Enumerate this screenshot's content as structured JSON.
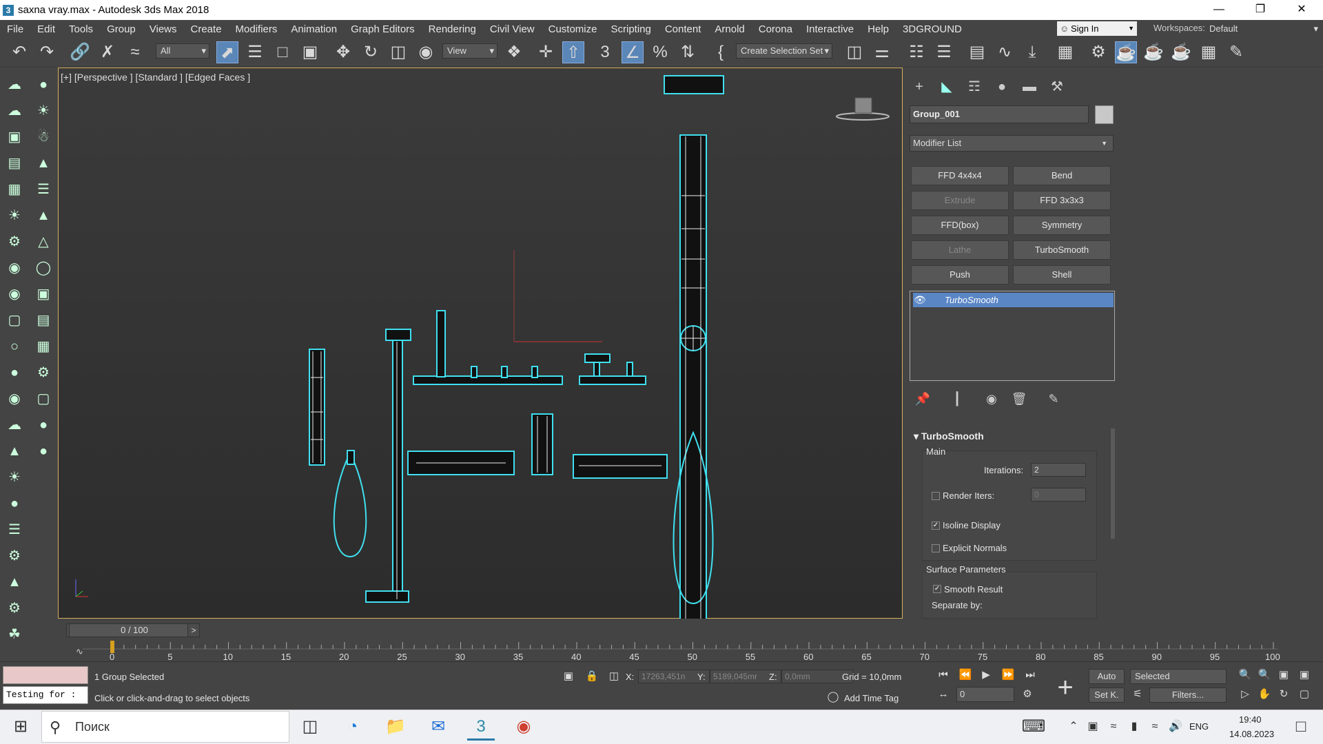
{
  "window": {
    "title": "saxna vray.max - Autodesk 3ds Max 2018",
    "minimize": "—",
    "restore": "❐",
    "close": "✕"
  },
  "menu": [
    "File",
    "Edit",
    "Tools",
    "Group",
    "Views",
    "Create",
    "Modifiers",
    "Animation",
    "Graph Editors",
    "Rendering",
    "Civil View",
    "Customize",
    "Scripting",
    "Content",
    "Arnold",
    "Corona",
    "Interactive",
    "Help",
    "3DGROUND"
  ],
  "signin": {
    "label": "Sign In"
  },
  "workspace": {
    "label": "Workspaces:",
    "value": "Default"
  },
  "toolbar": {
    "filter": "All",
    "refcoord": "View",
    "selset": "Create Selection Set"
  },
  "viewport": {
    "label": "[+] [Perspective ] [Standard ] [Edged Faces ]"
  },
  "command_panel": {
    "object_name": "Group_001",
    "modifier_list": "Modifier List",
    "buttons": [
      {
        "label": "FFD 4x4x4",
        "enabled": true
      },
      {
        "label": "Bend",
        "enabled": true
      },
      {
        "label": "Extrude",
        "enabled": false
      },
      {
        "label": "FFD 3x3x3",
        "enabled": true
      },
      {
        "label": "FFD(box)",
        "enabled": true
      },
      {
        "label": "Symmetry",
        "enabled": true
      },
      {
        "label": "Lathe",
        "enabled": false
      },
      {
        "label": "TurboSmooth",
        "enabled": true
      },
      {
        "label": "Push",
        "enabled": true
      },
      {
        "label": "Shell",
        "enabled": true
      }
    ],
    "stack_item": "TurboSmooth",
    "rollout": {
      "title": "TurboSmooth",
      "main": "Main",
      "iterations_label": "Iterations:",
      "iterations_value": "2",
      "render_iters_label": "Render Iters:",
      "render_iters_value": "0",
      "render_iters_checked": false,
      "isoline_label": "Isoline Display",
      "isoline_checked": true,
      "explicit_label": "Explicit Normals",
      "explicit_checked": false,
      "surface_label": "Surface Parameters",
      "smooth_label": "Smooth Result",
      "smooth_checked": true,
      "separate_label": "Separate by:"
    }
  },
  "timeline": {
    "frame": "0 / 100",
    "prev": "<",
    "next": ">",
    "ticks": [
      "0",
      "5",
      "10",
      "15",
      "20",
      "25",
      "30",
      "35",
      "40",
      "45",
      "50",
      "55",
      "60",
      "65",
      "70",
      "75",
      "80",
      "85",
      "90",
      "95",
      "100"
    ]
  },
  "status": {
    "maxscript_line": "Testing for :",
    "selected": "1 Group Selected",
    "prompt": "Click or click-and-drag to select objects",
    "x_label": "X:",
    "x_value": "17263,451n",
    "y_label": "Y:",
    "y_value": "5189,045mr",
    "z_label": "Z:",
    "z_value": "0,0mm",
    "grid": "Grid = 10,0mm",
    "add_time_tag": "Add Time Tag",
    "auto": "Auto",
    "setk": "Set K.",
    "selected_dropdown": "Selected",
    "filters": "Filters...",
    "frame_spinner": "0"
  },
  "taskbar": {
    "search": "Поиск",
    "lang": "ENG",
    "time": "19:40",
    "date": "14.08.2023"
  },
  "colors": {
    "selection_wire": "#40e0f0",
    "highlight": "#5a86c6",
    "viewport_border": "#d6b060"
  }
}
